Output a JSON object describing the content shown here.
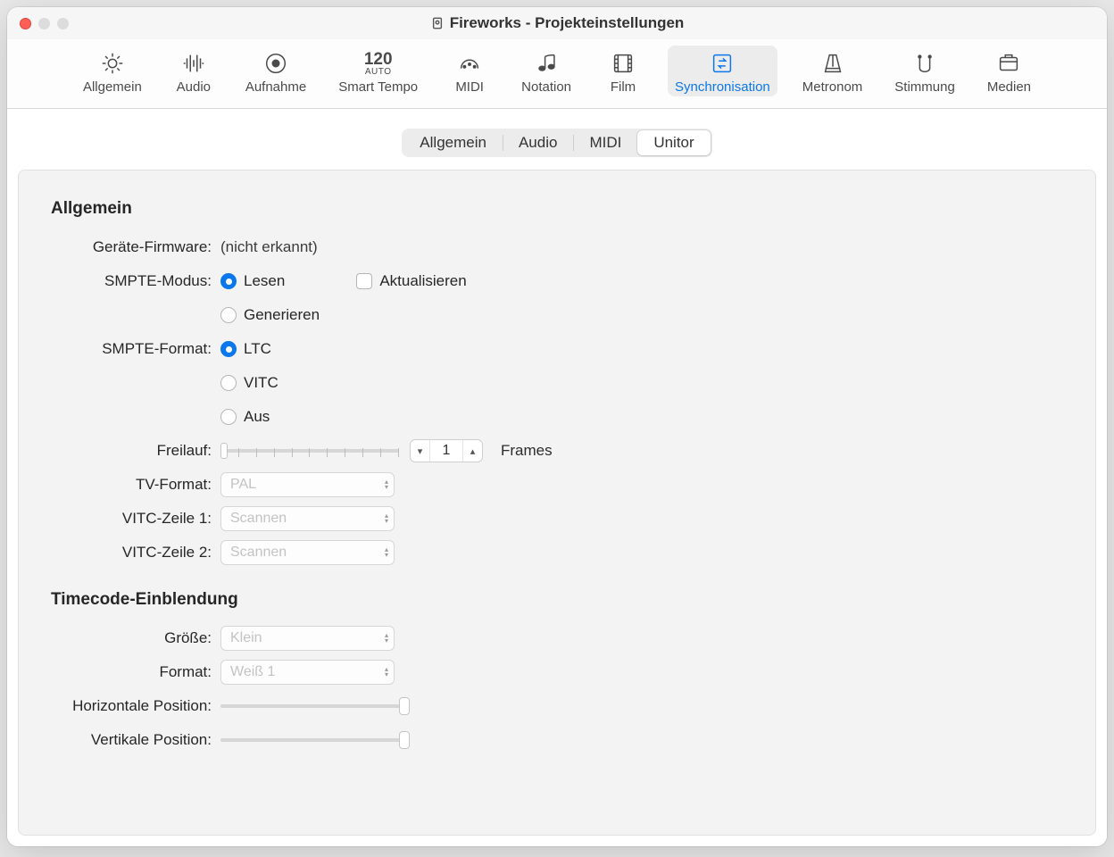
{
  "window_title": "Fireworks - Projekteinstellungen",
  "toolbar": [
    {
      "label": "Allgemein"
    },
    {
      "label": "Audio"
    },
    {
      "label": "Aufnahme"
    },
    {
      "label": "Smart Tempo"
    },
    {
      "label": "MIDI"
    },
    {
      "label": "Notation"
    },
    {
      "label": "Film"
    },
    {
      "label": "Synchronisation"
    },
    {
      "label": "Metronom"
    },
    {
      "label": "Stimmung"
    },
    {
      "label": "Medien"
    }
  ],
  "smart_tempo_number": "120",
  "smart_tempo_auto": "AUTO",
  "subtabs": [
    "Allgemein",
    "Audio",
    "MIDI",
    "Unitor"
  ],
  "subtab_active": "Unitor",
  "section_allgemein": "Allgemein",
  "labels": {
    "firmware": "Geräte-Firmware:",
    "smpte_modus": "SMPTE-Modus:",
    "smpte_format": "SMPTE-Format:",
    "freilauf": "Freilauf:",
    "tv_format": "TV-Format:",
    "vitc1": "VITC-Zeile 1:",
    "vitc2": "VITC-Zeile 2:",
    "groesse": "Größe:",
    "format": "Format:",
    "hpos": "Horizontale Position:",
    "vpos": "Vertikale Position:"
  },
  "values": {
    "firmware": "(nicht erkannt)",
    "smpte_modus_lesen": "Lesen",
    "smpte_modus_generieren": "Generieren",
    "smpte_modus_aktualisieren": "Aktualisieren",
    "smpte_format_ltc": "LTC",
    "smpte_format_vitc": "VITC",
    "smpte_format_aus": "Aus",
    "freilauf_value": "1",
    "freilauf_unit": "Frames",
    "tv_format": "PAL",
    "vitc1": "Scannen",
    "vitc2": "Scannen",
    "groesse": "Klein",
    "format": "Weiß 1"
  },
  "section_timecode": "Timecode-Einblendung"
}
